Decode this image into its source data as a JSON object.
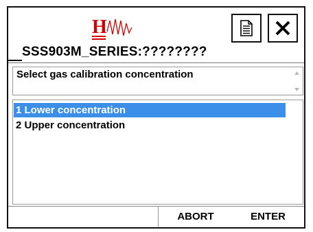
{
  "header": {
    "logo_icon": "hw-waveform-logo",
    "logo_text": "H",
    "document_icon": "document-icon",
    "close_icon": "close-icon",
    "device_title": "SSS903M_SERIES:????????"
  },
  "prompt": {
    "text": "Select gas calibration concentration"
  },
  "options": [
    {
      "label": "1 Lower concentration",
      "selected": true
    },
    {
      "label": "2 Upper concentration",
      "selected": false
    }
  ],
  "footer": {
    "abort_label": "ABORT",
    "enter_label": "ENTER"
  },
  "colors": {
    "selection": "#3b8fe8",
    "logo_red": "#d40000"
  }
}
